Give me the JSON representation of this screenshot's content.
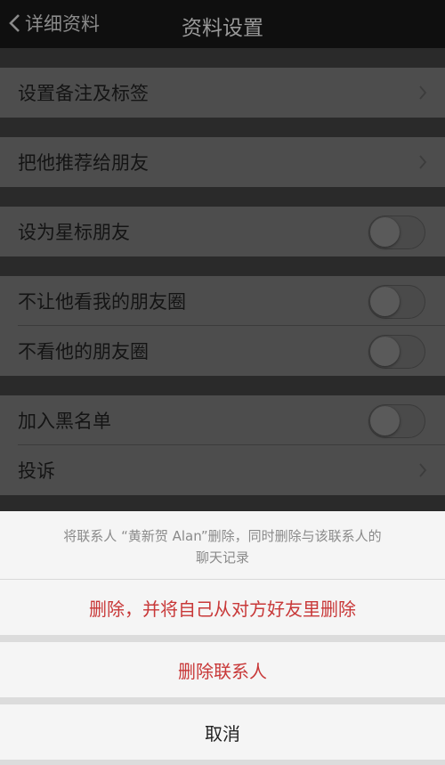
{
  "nav": {
    "back_label": "详细资料",
    "title": "资料设置"
  },
  "settings": {
    "groups": [
      {
        "items": [
          {
            "label": "设置备注及标签",
            "control": "chevron"
          }
        ]
      },
      {
        "items": [
          {
            "label": "把他推荐给朋友",
            "control": "chevron"
          }
        ]
      },
      {
        "items": [
          {
            "label": "设为星标朋友",
            "control": "toggle",
            "on": false
          }
        ]
      },
      {
        "items": [
          {
            "label": "不让他看我的朋友圈",
            "control": "toggle",
            "on": false
          },
          {
            "label": "不看他的朋友圈",
            "control": "toggle",
            "on": false
          }
        ]
      },
      {
        "items": [
          {
            "label": "加入黑名单",
            "control": "toggle",
            "on": false
          },
          {
            "label": "投诉",
            "control": "chevron"
          }
        ]
      }
    ]
  },
  "sheet": {
    "message_line1": "将联系人 “黄新贺 Alan”删除，同时删除与该联系人的",
    "message_line2": "聊天记录",
    "delete_mutual_label": "删除，并将自己从对方好友里删除",
    "delete_contact_label": "删除联系人",
    "cancel_label": "取消"
  },
  "colors": {
    "danger": "#c83838",
    "overlay_row": "#4d4d4d",
    "nav": "#0f0f0f"
  }
}
